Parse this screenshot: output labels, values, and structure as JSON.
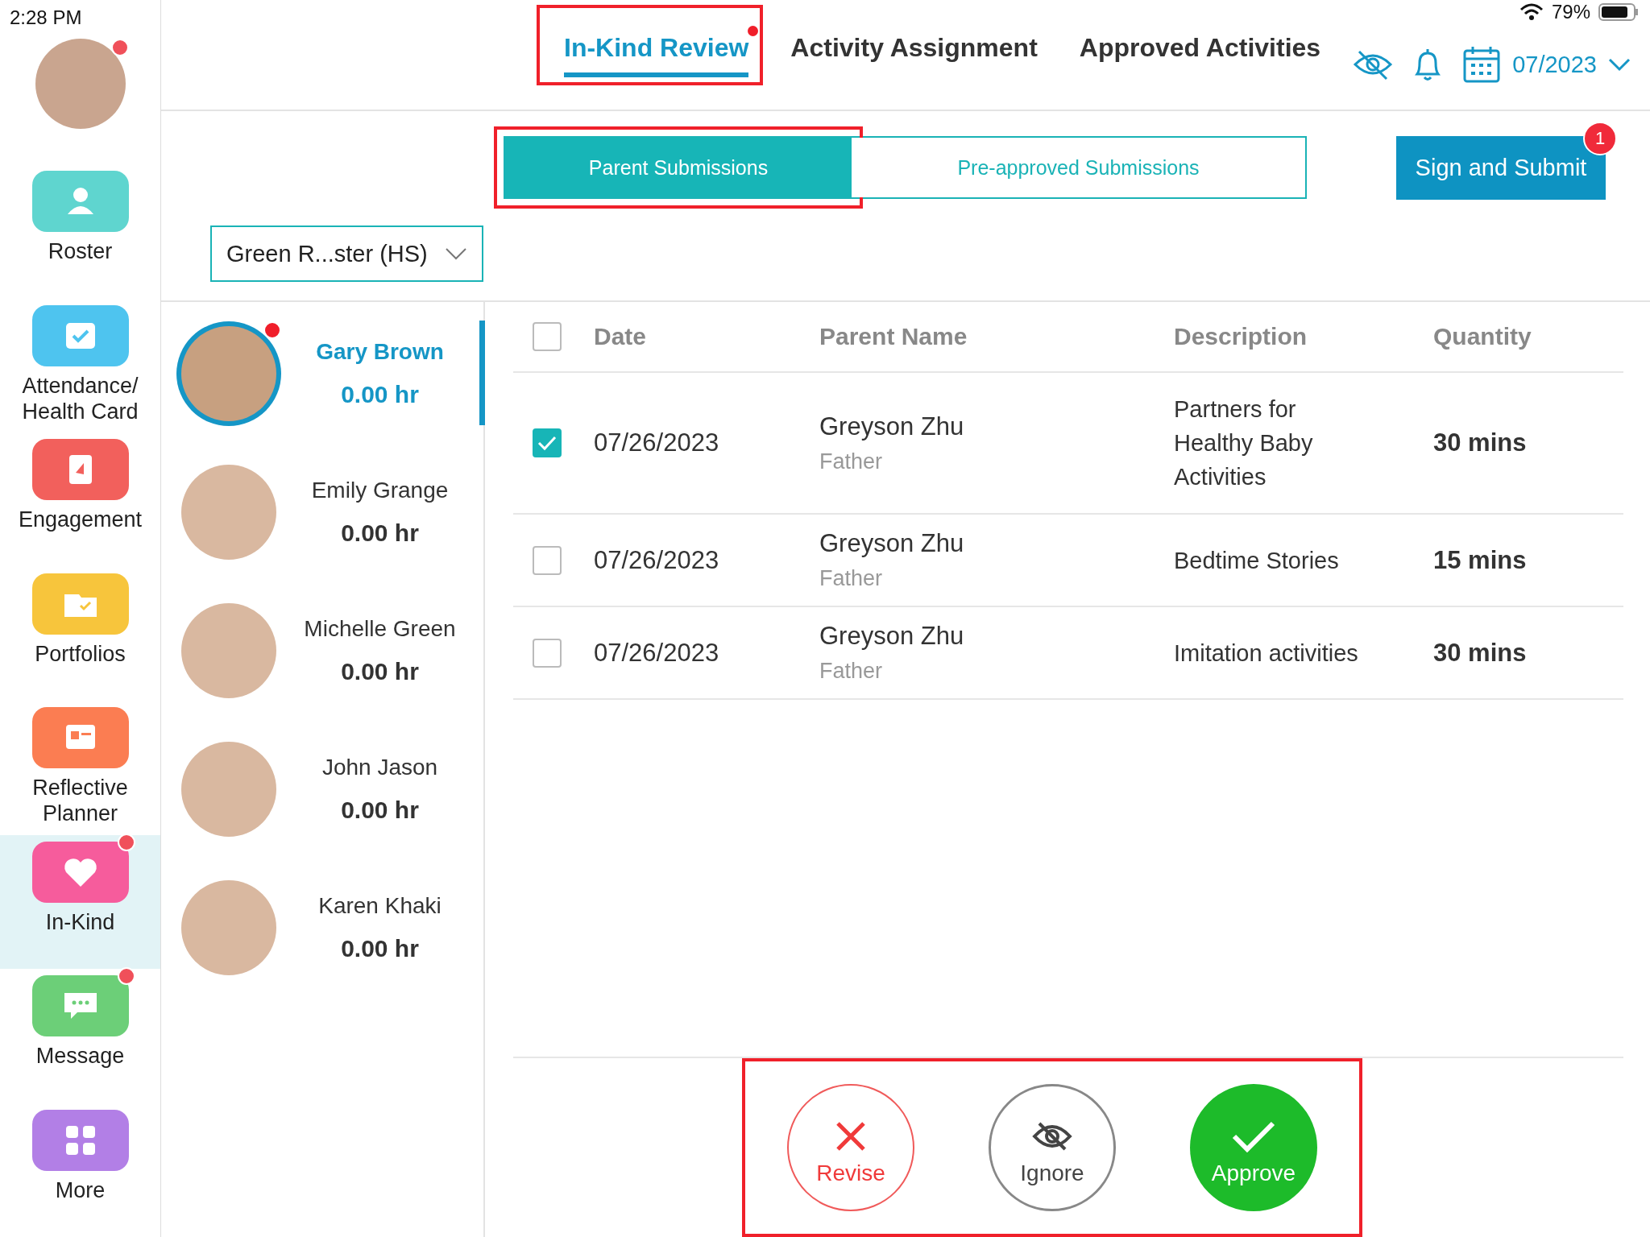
{
  "status_bar": {
    "time": "2:28 PM",
    "battery": "79%"
  },
  "profile": {
    "badge": true
  },
  "sidebar": {
    "items": [
      {
        "kind": "roster",
        "label": "Roster",
        "selected": false,
        "badge": false
      },
      {
        "kind": "attendance",
        "label": "Attendance/\nHealth Card",
        "selected": false,
        "badge": false
      },
      {
        "kind": "engagement",
        "label": "Engagement",
        "selected": false,
        "badge": false
      },
      {
        "kind": "portfolios",
        "label": "Portfolios",
        "selected": false,
        "badge": false
      },
      {
        "kind": "planner",
        "label": "Reflective\nPlanner",
        "selected": false,
        "badge": false
      },
      {
        "kind": "inkind",
        "label": "In-Kind",
        "selected": true,
        "badge": true
      },
      {
        "kind": "message",
        "label": "Message",
        "selected": false,
        "badge": true
      },
      {
        "kind": "more",
        "label": "More",
        "selected": false,
        "badge": false
      }
    ]
  },
  "tabs": [
    {
      "label": "In-Kind Review",
      "selected": true,
      "badge": true,
      "highlighted": true
    },
    {
      "label": "Activity Assignment",
      "selected": false,
      "badge": false,
      "highlighted": false
    },
    {
      "label": "Approved Activities",
      "selected": false,
      "badge": false,
      "highlighted": false
    }
  ],
  "month": "07/2023",
  "segments": [
    {
      "label": "Parent Submissions",
      "selected": true,
      "highlighted": true
    },
    {
      "label": "Pre-approved Submissions",
      "selected": false,
      "highlighted": false
    }
  ],
  "sign_button": {
    "label": "Sign and Submit",
    "badge": "1"
  },
  "class_dropdown": "Green R...ster (HS)",
  "students": [
    {
      "name": "Gary Brown",
      "hours": "0.00 hr",
      "selected": true,
      "badge": true
    },
    {
      "name": "Emily Grange",
      "hours": "0.00 hr",
      "selected": false,
      "badge": false
    },
    {
      "name": "Michelle Green",
      "hours": "0.00 hr",
      "selected": false,
      "badge": false
    },
    {
      "name": "John Jason",
      "hours": "0.00 hr",
      "selected": false,
      "badge": false
    },
    {
      "name": "Karen Khaki",
      "hours": "0.00 hr",
      "selected": false,
      "badge": false
    }
  ],
  "table": {
    "select_all": false,
    "columns": [
      "Date",
      "Parent Name",
      "Description",
      "Quantity"
    ],
    "rows": [
      {
        "checked": true,
        "date": "07/26/2023",
        "parent": "Greyson Zhu",
        "relation": "Father",
        "description": "Partners for Healthy Baby Activities",
        "quantity": "30 mins"
      },
      {
        "checked": false,
        "date": "07/26/2023",
        "parent": "Greyson Zhu",
        "relation": "Father",
        "description": "Bedtime Stories",
        "quantity": "15 mins"
      },
      {
        "checked": false,
        "date": "07/26/2023",
        "parent": "Greyson Zhu",
        "relation": "Father",
        "description": "Imitation activities",
        "quantity": "30 mins"
      }
    ]
  },
  "actions": {
    "highlighted": true,
    "buttons": [
      {
        "kind": "revise",
        "label": "Revise"
      },
      {
        "kind": "ignore",
        "label": "Ignore"
      },
      {
        "kind": "approve",
        "label": "Approve"
      }
    ]
  }
}
